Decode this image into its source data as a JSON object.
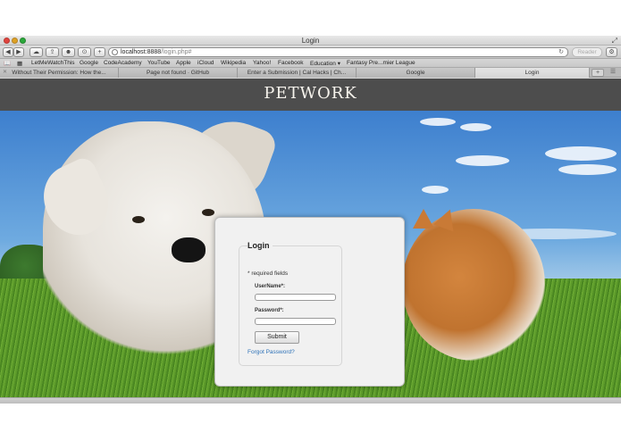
{
  "window": {
    "title": "Login",
    "fullscreen_icon": "⤢"
  },
  "toolbar": {
    "back": "◀",
    "forward": "▶",
    "icloud": "☁",
    "share": "⇪",
    "reading_list": "☻",
    "downloads": "⊙",
    "add_bookmark": "+",
    "url_host": "localhost:8888",
    "url_path": "/login.php#",
    "reload": "↻",
    "reader_label": "Reader",
    "settings_icon": "⚙"
  },
  "bookmarks": {
    "sidebar_icon": "📖",
    "topsites_icon": "▦",
    "items": [
      "LetMeWatchThis",
      "Google",
      "CodeAcademy",
      "YouTube",
      "Apple",
      "iCloud",
      "Wikipedia",
      "Yahoo!",
      "Facebook",
      "Education ▾",
      "Fantasy Pre...mier League"
    ]
  },
  "tabs": {
    "items": [
      "Without Their Permission: How the...",
      "Page not found · GitHub",
      "Enter a Submission | Cal Hacks | Ch...",
      "Google",
      "Login"
    ],
    "new_tab": "+",
    "tab_list": "☰"
  },
  "page": {
    "brand": "PETWORK",
    "login": {
      "title": "Login",
      "required_note": "* required fields",
      "username_label": "UserName*:",
      "password_label": "Password*:",
      "username_value": "",
      "password_value": "",
      "submit_label": "Submit",
      "forgot_label": "Forgot Password?"
    }
  },
  "colors": {
    "header_bg": "#4d4d4d",
    "brand_text": "#f6f3ec",
    "link": "#2e72b8",
    "modal_bg": "#f1f1f1"
  }
}
